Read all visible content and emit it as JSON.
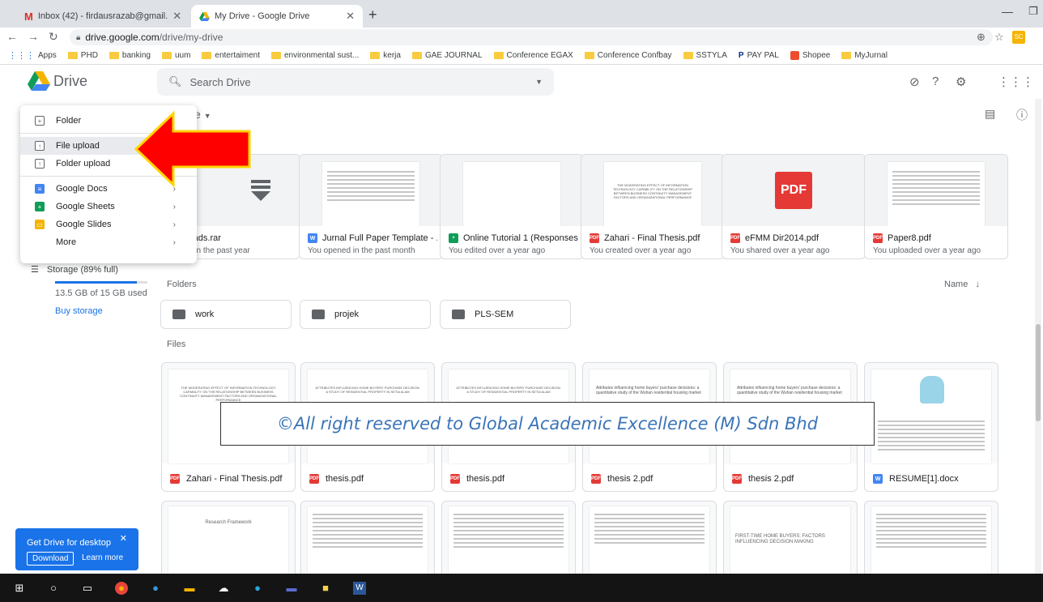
{
  "browser": {
    "tabs": [
      {
        "title": "Inbox (42) - firdausrazab@gmail.",
        "icon": "gmail-icon"
      },
      {
        "title": "My Drive - Google Drive",
        "icon": "drive-icon"
      }
    ],
    "url_host": "drive.google.com",
    "url_path": "/drive/my-drive",
    "profile_badge": "SC",
    "bookmarks": [
      "Apps",
      "PHD",
      "banking",
      "uum",
      "entertaiment",
      "environmental sust...",
      "kerja",
      "GAE JOURNAL",
      "Conference EGAX",
      "Conference Confbay",
      "SSTYLA",
      "PAY PAL",
      "Shopee",
      "MyJurnal"
    ]
  },
  "drive": {
    "logo_text": "Drive",
    "search_placeholder": "Search Drive",
    "title_fragment": "e"
  },
  "new_menu": {
    "folder": "Folder",
    "file_upload": "File upload",
    "folder_upload": "Folder upload",
    "docs": "Google Docs",
    "sheets": "Google Sheets",
    "slides": "Google Slides",
    "more": "More"
  },
  "sidebar": {
    "storage_label": "Storage (89% full)",
    "storage_fraction": 0.89,
    "storage_used": "13.5 GB of 15 GB used",
    "buy_storage": "Buy storage"
  },
  "quick_access": [
    {
      "name": "nloads.rar",
      "sub": "d in the past year",
      "type": "rar"
    },
    {
      "name": "Jurnal Full Paper Template - ...",
      "sub": "You opened in the past month",
      "type": "word"
    },
    {
      "name": "Online Tutorial 1 (Responses)",
      "sub": "You edited over a year ago",
      "type": "sheet"
    },
    {
      "name": "Zahari - Final Thesis.pdf",
      "sub": "You created over a year ago",
      "type": "pdf"
    },
    {
      "name": "eFMM Dir2014.pdf",
      "sub": "You shared over a year ago",
      "type": "pdf"
    },
    {
      "name": "Paper8.pdf",
      "sub": "You uploaded over a year ago",
      "type": "pdf"
    }
  ],
  "folders_label": "Folders",
  "sort_label": "Name",
  "folders": [
    "work",
    "projek",
    "PLS-SEM"
  ],
  "files_label": "Files",
  "files": [
    {
      "name": "Zahari - Final Thesis.pdf",
      "type": "pdf"
    },
    {
      "name": "thesis.pdf",
      "type": "pdf"
    },
    {
      "name": "thesis.pdf",
      "type": "pdf"
    },
    {
      "name": "thesis 2.pdf",
      "type": "pdf"
    },
    {
      "name": "thesis 2.pdf",
      "type": "pdf"
    },
    {
      "name": "RESUME[1].docx",
      "type": "word"
    }
  ],
  "thumb_texts": {
    "thesis_title": "THE MODERATING EFFECT OF INFORMATION TECHNOLOGY CAPABILITY ON THE RELATIONSHIP BETWEEN BUSINESS CONTINUITY MANAGEMENT FACTORS AND ORGANIZATIONAL PERFORMANCE",
    "attributes_title": "ATTRIBUTES INFLUENCING HOME BUYERS' PURCHASE DECISION: A STUDY OF RESIDENTIAL PROPERTY IN SETIA ALAM",
    "attributes_hand": "Attributes influencing home buyers' purchase decisions: a quantitative study of the Wuhan residential housing market",
    "first_time": "FIRST-TIME HOME BUYERS: FACTORS INFLUENCING DECISION MAKING",
    "research_framework": "Research Framework",
    "pdf_badge": "PDF"
  },
  "watermark": "©All right reserved to Global Academic Excellence (M) Sdn Bhd",
  "promo": {
    "title": "Get Drive for desktop",
    "download": "Download",
    "learn": "Learn more"
  },
  "colors": {
    "accent": "#1a73e8",
    "arrow_red": "#ff0000",
    "arrow_border": "#ffd400",
    "pdf_red": "#e53935"
  }
}
